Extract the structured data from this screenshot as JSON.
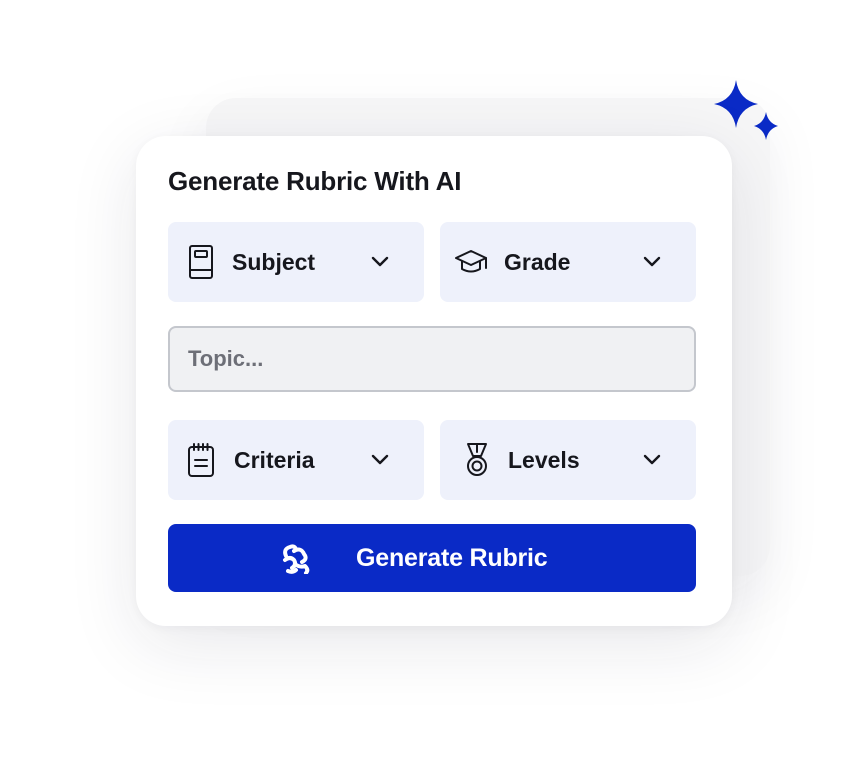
{
  "card": {
    "title": "Generate Rubric With AI"
  },
  "selects": {
    "subject": {
      "label": "Subject",
      "icon": "book-icon"
    },
    "grade": {
      "label": "Grade",
      "icon": "graduation-cap-icon"
    },
    "criteria": {
      "label": "Criteria",
      "icon": "notepad-icon"
    },
    "levels": {
      "label": "Levels",
      "icon": "medal-icon"
    }
  },
  "topic": {
    "placeholder": "Topic...",
    "value": ""
  },
  "generate_button": {
    "label": "Generate Rubric",
    "icon": "brain-icon"
  },
  "decor": {
    "icon": "sparkles-icon"
  },
  "colors": {
    "accent": "#0a2ac6",
    "select_bg": "#eef1fb",
    "text": "#16171d"
  }
}
